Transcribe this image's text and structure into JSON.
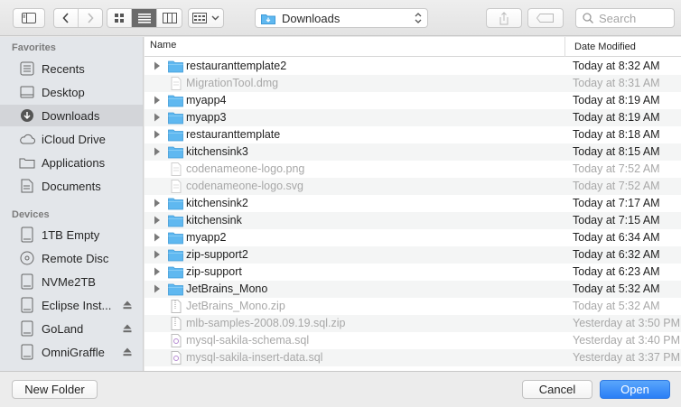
{
  "toolbar": {
    "location": "Downloads",
    "search_placeholder": "Search"
  },
  "sidebar": {
    "favorites_header": "Favorites",
    "favorites": [
      {
        "label": "Recents",
        "icon": "recents-icon"
      },
      {
        "label": "Desktop",
        "icon": "desktop-icon"
      },
      {
        "label": "Downloads",
        "icon": "downloads-icon",
        "selected": true
      },
      {
        "label": "iCloud Drive",
        "icon": "icloud-icon"
      },
      {
        "label": "Applications",
        "icon": "applications-icon"
      },
      {
        "label": "Documents",
        "icon": "documents-icon"
      }
    ],
    "devices_header": "Devices",
    "devices": [
      {
        "label": "1TB Empty",
        "icon": "drive-icon"
      },
      {
        "label": "Remote Disc",
        "icon": "disc-icon"
      },
      {
        "label": "NVMe2TB",
        "icon": "drive-icon"
      },
      {
        "label": "Eclipse Inst...",
        "icon": "drive-icon",
        "eject": true
      },
      {
        "label": "GoLand",
        "icon": "drive-icon",
        "eject": true
      },
      {
        "label": "OmniGraffle",
        "icon": "drive-icon",
        "eject": true
      }
    ]
  },
  "columns": {
    "name": "Name",
    "date": "Date Modified"
  },
  "files": [
    {
      "name": "restauranttemplate2",
      "date": "Today at 8:32 AM",
      "type": "folder"
    },
    {
      "name": "MigrationTool.dmg",
      "date": "Today at 8:31 AM",
      "type": "file"
    },
    {
      "name": "myapp4",
      "date": "Today at 8:19 AM",
      "type": "folder"
    },
    {
      "name": "myapp3",
      "date": "Today at 8:19 AM",
      "type": "folder"
    },
    {
      "name": "restauranttemplate",
      "date": "Today at 8:18 AM",
      "type": "folder"
    },
    {
      "name": "kitchensink3",
      "date": "Today at 8:15 AM",
      "type": "folder"
    },
    {
      "name": "codenameone-logo.png",
      "date": "Today at 7:52 AM",
      "type": "file"
    },
    {
      "name": "codenameone-logo.svg",
      "date": "Today at 7:52 AM",
      "type": "file"
    },
    {
      "name": "kitchensink2",
      "date": "Today at 7:17 AM",
      "type": "folder"
    },
    {
      "name": "kitchensink",
      "date": "Today at 7:15 AM",
      "type": "folder"
    },
    {
      "name": "myapp2",
      "date": "Today at 6:34 AM",
      "type": "folder"
    },
    {
      "name": "zip-support2",
      "date": "Today at 6:32 AM",
      "type": "folder"
    },
    {
      "name": "zip-support",
      "date": "Today at 6:23 AM",
      "type": "folder"
    },
    {
      "name": "JetBrains_Mono",
      "date": "Today at 5:32 AM",
      "type": "folder"
    },
    {
      "name": "JetBrains_Mono.zip",
      "date": "Today at 5:32 AM",
      "type": "zip"
    },
    {
      "name": "mlb-samples-2008.09.19.sql.zip",
      "date": "Yesterday at 3:50 PM",
      "type": "zip"
    },
    {
      "name": "mysql-sakila-schema.sql",
      "date": "Yesterday at 3:40 PM",
      "type": "sql"
    },
    {
      "name": "mysql-sakila-insert-data.sql",
      "date": "Yesterday at 3:37 PM",
      "type": "sql"
    }
  ],
  "footer": {
    "new_folder": "New Folder",
    "cancel": "Cancel",
    "open": "Open"
  },
  "colors": {
    "folder": "#5fb8f0",
    "primary": "#2a7ff6",
    "selected_sidebar": "#d3d5d9"
  }
}
